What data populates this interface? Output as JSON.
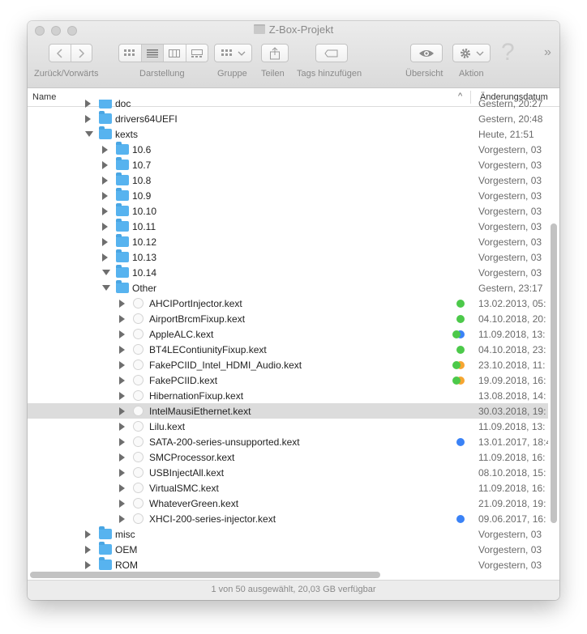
{
  "window": {
    "title": "Z-Box-Projekt",
    "status": "1 von 50 ausgewählt, 20,03 GB verfügbar"
  },
  "toolbar": {
    "back_forward_label": "Zurück/Vorwärts",
    "view_label": "Darstellung",
    "group_label": "Gruppe",
    "share_label": "Teilen",
    "tags_label": "Tags hinzufügen",
    "overview_label": "Übersicht",
    "action_label": "Aktion",
    "more_glyph": "»",
    "help_glyph": "?"
  },
  "columns": {
    "name": "Name",
    "date": "Änderungsdatum"
  },
  "tag_colors": {
    "green": "#4cc94a",
    "blue": "#3a82f6",
    "orange": "#f6a531"
  },
  "rows": [
    {
      "name": "doc",
      "date": "Gestern, 20:27",
      "kind": "folder",
      "indent": 0,
      "expand": "closed"
    },
    {
      "name": "drivers64UEFI",
      "date": "Gestern, 20:48",
      "kind": "folder",
      "indent": 0,
      "expand": "closed"
    },
    {
      "name": "kexts",
      "date": "Heute, 21:51",
      "kind": "folder",
      "indent": 0,
      "expand": "open"
    },
    {
      "name": "10.6",
      "date": "Vorgestern, 03",
      "kind": "folder",
      "indent": 1,
      "expand": "closed"
    },
    {
      "name": "10.7",
      "date": "Vorgestern, 03",
      "kind": "folder",
      "indent": 1,
      "expand": "closed"
    },
    {
      "name": "10.8",
      "date": "Vorgestern, 03",
      "kind": "folder",
      "indent": 1,
      "expand": "closed"
    },
    {
      "name": "10.9",
      "date": "Vorgestern, 03",
      "kind": "folder",
      "indent": 1,
      "expand": "closed"
    },
    {
      "name": "10.10",
      "date": "Vorgestern, 03",
      "kind": "folder",
      "indent": 1,
      "expand": "closed"
    },
    {
      "name": "10.11",
      "date": "Vorgestern, 03",
      "kind": "folder",
      "indent": 1,
      "expand": "closed"
    },
    {
      "name": "10.12",
      "date": "Vorgestern, 03",
      "kind": "folder",
      "indent": 1,
      "expand": "closed"
    },
    {
      "name": "10.13",
      "date": "Vorgestern, 03",
      "kind": "folder",
      "indent": 1,
      "expand": "closed"
    },
    {
      "name": "10.14",
      "date": "Vorgestern, 03",
      "kind": "folder",
      "indent": 1,
      "expand": "open"
    },
    {
      "name": "Other",
      "date": "Gestern, 23:17",
      "kind": "folder",
      "indent": 1,
      "expand": "open"
    },
    {
      "name": "AHCIPortInjector.kext",
      "date": "13.02.2013, 05:",
      "kind": "kext",
      "indent": 2,
      "expand": "closed",
      "tags": [
        "green"
      ]
    },
    {
      "name": "AirportBrcmFixup.kext",
      "date": "04.10.2018, 20:",
      "kind": "kext",
      "indent": 2,
      "expand": "closed",
      "tags": [
        "green"
      ]
    },
    {
      "name": "AppleALC.kext",
      "date": "11.09.2018, 13:",
      "kind": "kext",
      "indent": 2,
      "expand": "closed",
      "tags": [
        "green",
        "blue"
      ]
    },
    {
      "name": "BT4LEContiunityFixup.kext",
      "date": "04.10.2018, 23:",
      "kind": "kext",
      "indent": 2,
      "expand": "closed",
      "tags": [
        "green"
      ]
    },
    {
      "name": "FakePCIID_Intel_HDMI_Audio.kext",
      "date": "23.10.2018, 11:",
      "kind": "kext",
      "indent": 2,
      "expand": "closed",
      "tags": [
        "green",
        "orange"
      ]
    },
    {
      "name": "FakePCIID.kext",
      "date": "19.09.2018, 16:",
      "kind": "kext",
      "indent": 2,
      "expand": "closed",
      "tags": [
        "green",
        "orange"
      ]
    },
    {
      "name": "HibernationFixup.kext",
      "date": "13.08.2018, 14:",
      "kind": "kext",
      "indent": 2,
      "expand": "closed"
    },
    {
      "name": "IntelMausiEthernet.kext",
      "date": "30.03.2018, 19:",
      "kind": "kext",
      "indent": 2,
      "expand": "closed",
      "selected": true
    },
    {
      "name": "Lilu.kext",
      "date": "11.09.2018, 13:",
      "kind": "kext",
      "indent": 2,
      "expand": "closed"
    },
    {
      "name": "SATA-200-series-unsupported.kext",
      "date": "13.01.2017, 18:4",
      "kind": "kext",
      "indent": 2,
      "expand": "closed",
      "tags": [
        "blue"
      ]
    },
    {
      "name": "SMCProcessor.kext",
      "date": "11.09.2018, 16:",
      "kind": "kext",
      "indent": 2,
      "expand": "closed"
    },
    {
      "name": "USBInjectAll.kext",
      "date": "08.10.2018, 15:",
      "kind": "kext",
      "indent": 2,
      "expand": "closed"
    },
    {
      "name": "VirtualSMC.kext",
      "date": "11.09.2018, 16:",
      "kind": "kext",
      "indent": 2,
      "expand": "closed"
    },
    {
      "name": "WhateverGreen.kext",
      "date": "21.09.2018, 19:",
      "kind": "kext",
      "indent": 2,
      "expand": "closed"
    },
    {
      "name": "XHCI-200-series-injector.kext",
      "date": "09.06.2017, 16:",
      "kind": "kext",
      "indent": 2,
      "expand": "closed",
      "tags": [
        "blue"
      ]
    },
    {
      "name": "misc",
      "date": "Vorgestern, 03",
      "kind": "folder",
      "indent": 0,
      "expand": "closed"
    },
    {
      "name": "OEM",
      "date": "Vorgestern, 03",
      "kind": "folder",
      "indent": 0,
      "expand": "closed"
    },
    {
      "name": "ROM",
      "date": "Vorgestern, 03",
      "kind": "folder",
      "indent": 0,
      "expand": "closed"
    }
  ]
}
